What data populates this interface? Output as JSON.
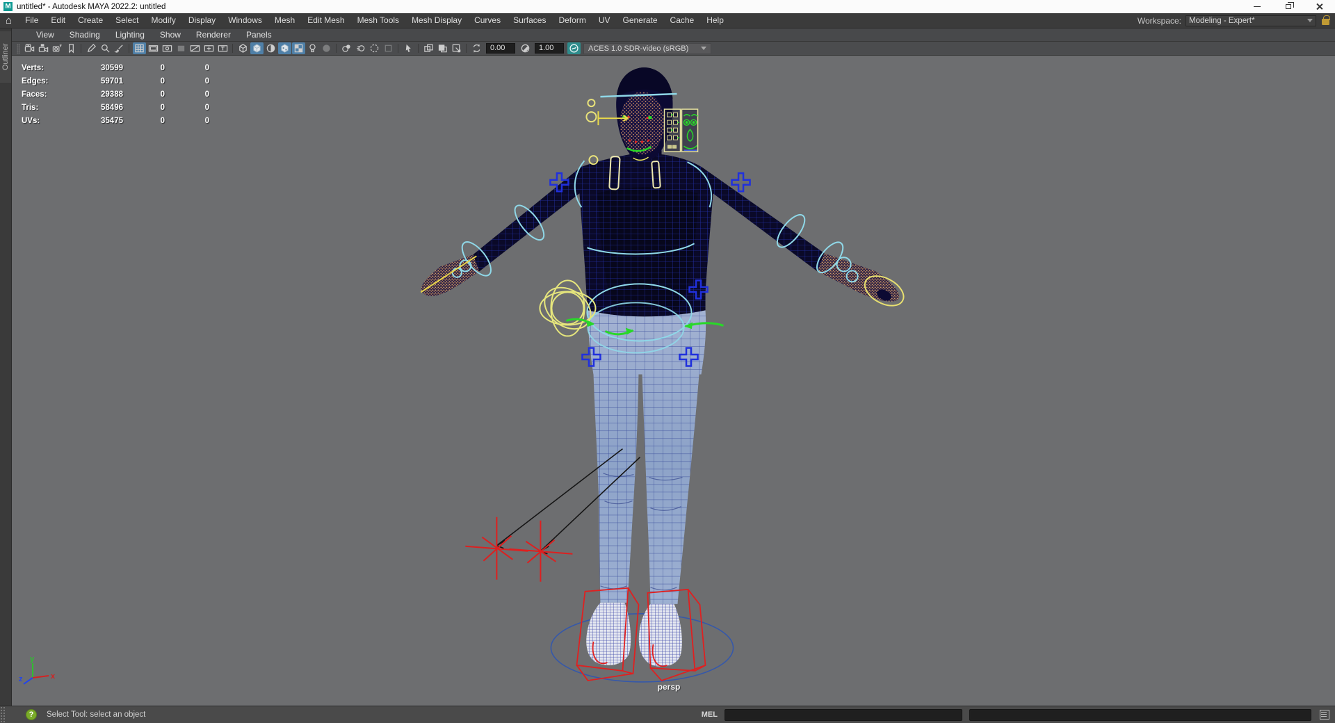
{
  "window": {
    "title": "untitled* - Autodesk MAYA 2022.2: untitled",
    "app_icon_letter": "M",
    "controls": [
      "minimize",
      "restore",
      "close"
    ]
  },
  "glyphs": {
    "home": "⌂"
  },
  "menu_bar": {
    "items": [
      "File",
      "Edit",
      "Create",
      "Select",
      "Modify",
      "Display",
      "Windows",
      "Mesh",
      "Edit Mesh",
      "Mesh Tools",
      "Mesh Display",
      "Curves",
      "Surfaces",
      "Deform",
      "UV",
      "Generate",
      "Cache",
      "Help"
    ],
    "workspace_label": "Workspace:",
    "workspace_value": "Modeling - Expert*"
  },
  "outliner_tab": "Outliner",
  "panel_menu": {
    "items": [
      "View",
      "Shading",
      "Lighting",
      "Show",
      "Renderer",
      "Panels"
    ]
  },
  "viewport_toolbar": {
    "icons": [
      {
        "name": "toolbar-grip",
        "shape": "grip",
        "state": "normal"
      },
      {
        "name": "select-camera",
        "shape": "camera",
        "state": "normal"
      },
      {
        "name": "lock-camera",
        "shape": "camlock",
        "state": "normal"
      },
      {
        "name": "camera-attributes",
        "shape": "camgate",
        "state": "normal"
      },
      {
        "name": "bookmarks",
        "shape": "bookmark",
        "state": "normal"
      },
      {
        "name": "separator",
        "shape": "sep",
        "state": "normal"
      },
      {
        "name": "image-plane",
        "shape": "pencil",
        "state": "normal"
      },
      {
        "name": "2d-pan-zoom",
        "shape": "magnifier",
        "state": "normal"
      },
      {
        "name": "grease-pencil",
        "shape": "brush",
        "state": "normal"
      },
      {
        "name": "separator",
        "shape": "sep",
        "state": "normal"
      },
      {
        "name": "grid",
        "shape": "grid",
        "state": "active"
      },
      {
        "name": "film-gate",
        "shape": "gate",
        "state": "normal"
      },
      {
        "name": "resolution-gate",
        "shape": "gate2",
        "state": "normal"
      },
      {
        "name": "gate-mask",
        "shape": "mask",
        "state": "dim"
      },
      {
        "name": "field-chart",
        "shape": "chart",
        "state": "normal"
      },
      {
        "name": "safe-action",
        "shape": "safea",
        "state": "normal"
      },
      {
        "name": "safe-title",
        "shape": "safet",
        "state": "normal"
      },
      {
        "name": "separator",
        "shape": "sep",
        "state": "normal"
      },
      {
        "name": "wireframe",
        "shape": "cubewire",
        "state": "normal"
      },
      {
        "name": "smooth-shade-all",
        "shape": "cube",
        "state": "active"
      },
      {
        "name": "use-default-material",
        "shape": "half",
        "state": "normal"
      },
      {
        "name": "shade-textured",
        "shape": "cubetex",
        "state": "active"
      },
      {
        "name": "wireframe-on-shaded",
        "shape": "checker",
        "state": "active"
      },
      {
        "name": "lighting",
        "shape": "bulb",
        "state": "normal"
      },
      {
        "name": "shadows",
        "shape": "sphere",
        "state": "dim"
      },
      {
        "name": "separator",
        "shape": "sep",
        "state": "normal"
      },
      {
        "name": "screen-space-ao",
        "shape": "ao",
        "state": "normal"
      },
      {
        "name": "motion-blur",
        "shape": "mblur",
        "state": "normal"
      },
      {
        "name": "anti-aliasing",
        "shape": "dashc",
        "state": "normal"
      },
      {
        "name": "depth-peeling",
        "shape": "sqdim",
        "state": "dim"
      },
      {
        "name": "separator",
        "shape": "sep",
        "state": "normal"
      },
      {
        "name": "isolate-select",
        "shape": "arrow",
        "state": "normal"
      },
      {
        "name": "separator",
        "shape": "sep",
        "state": "normal"
      },
      {
        "name": "snapshot-copy",
        "shape": "copy",
        "state": "normal"
      },
      {
        "name": "snapshot-paste",
        "shape": "paste",
        "state": "normal"
      },
      {
        "name": "region-crop",
        "shape": "crop",
        "state": "normal"
      },
      {
        "name": "separator",
        "shape": "sep",
        "state": "normal"
      }
    ],
    "exposure_value": "0.00",
    "gamma_value": "1.00",
    "color_space": "ACES 1.0 SDR-video (sRGB)"
  },
  "hud": {
    "rows": [
      {
        "label": "Verts:",
        "values": [
          "30599",
          "0",
          "0"
        ]
      },
      {
        "label": "Edges:",
        "values": [
          "59701",
          "0",
          "0"
        ]
      },
      {
        "label": "Faces:",
        "values": [
          "29388",
          "0",
          "0"
        ]
      },
      {
        "label": "Tris:",
        "values": [
          "58496",
          "0",
          "0"
        ]
      },
      {
        "label": "UVs:",
        "values": [
          "35475",
          "0",
          "0"
        ]
      }
    ]
  },
  "viewport": {
    "camera_label": "persp",
    "axis_labels": {
      "x": "x",
      "y": "y",
      "z": "z"
    }
  },
  "status_bar": {
    "help_text": "Select Tool: select an object",
    "mel_label": "MEL"
  },
  "colors": {
    "viewport_bg": "#6d6e70",
    "toolbar_active": "#4f80a8",
    "sweater_wire": "#2b3cd4",
    "jeans_wire": "#24368f",
    "control_yellow": "#e8e27a",
    "control_cyan": "#8fd8e8",
    "control_green": "#28d828",
    "control_blue_plus": "#2030dd",
    "control_red": "#dd2020",
    "ground_circle": "#3558aa"
  }
}
